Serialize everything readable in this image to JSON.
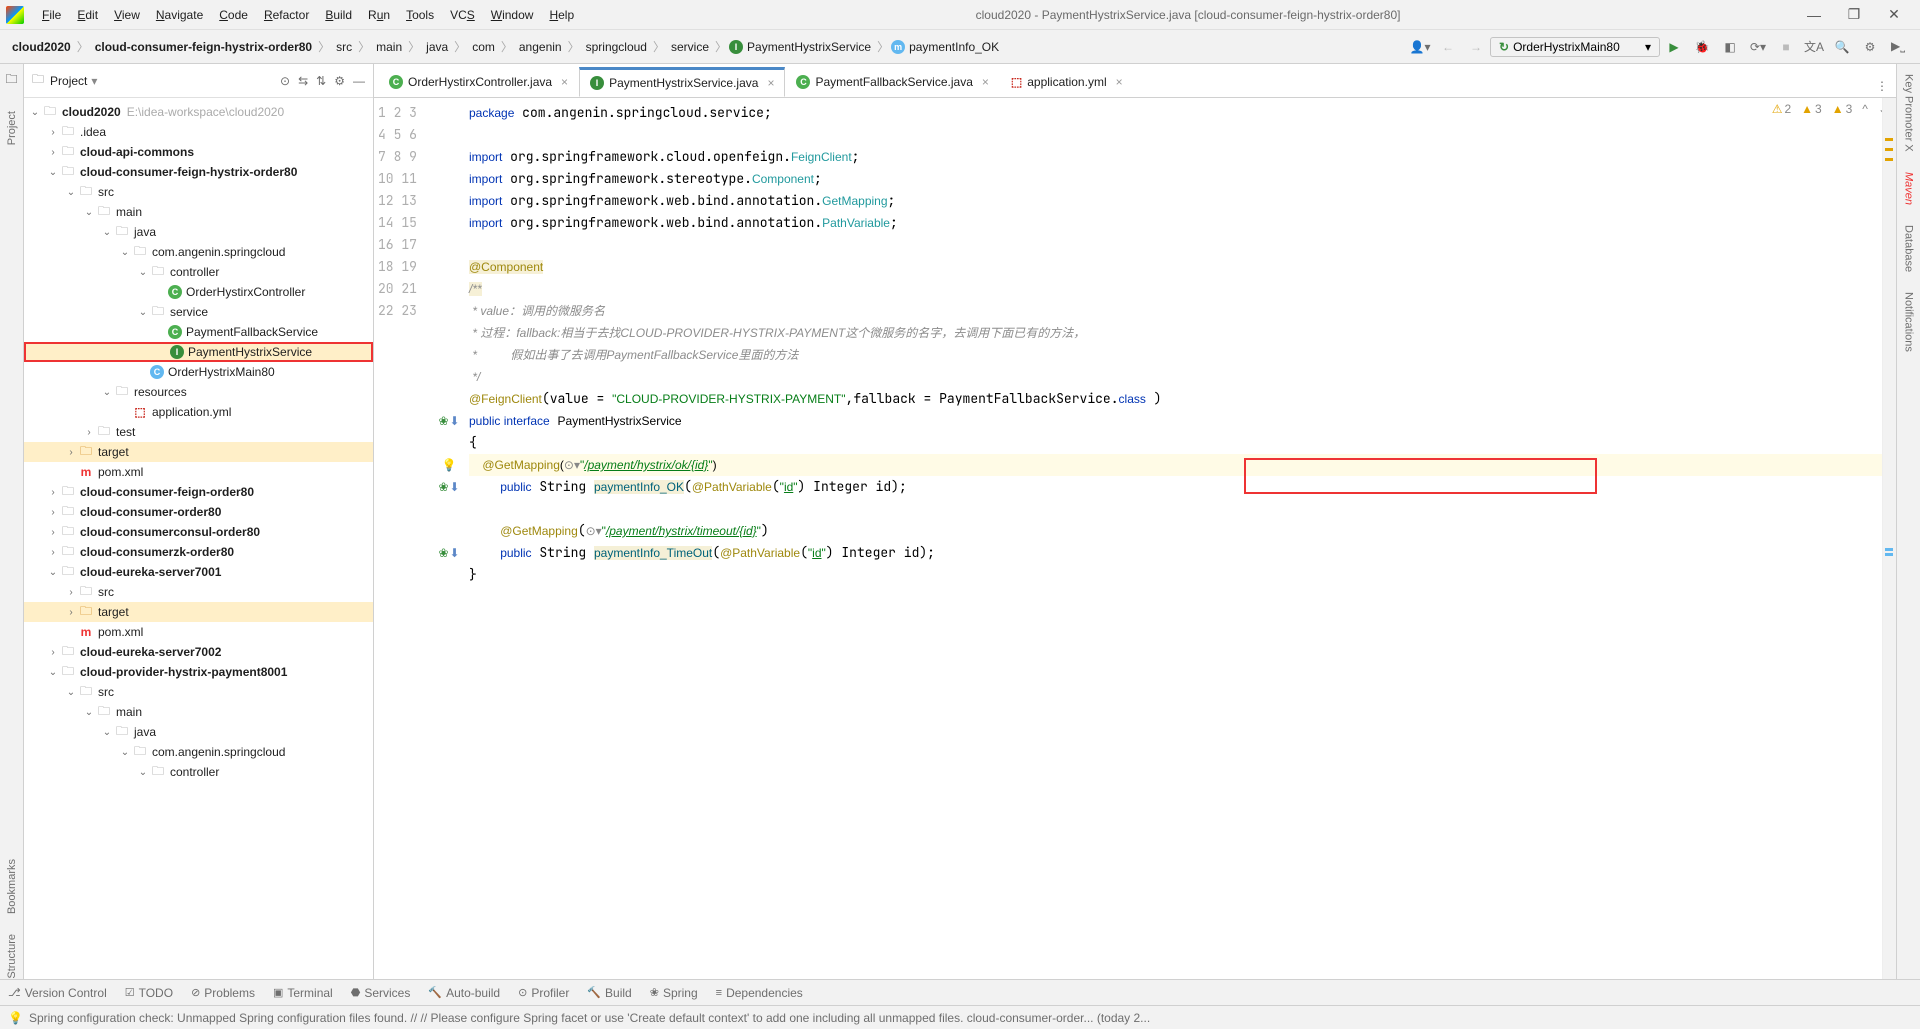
{
  "window": {
    "title": "cloud2020 - PaymentHystrixService.java [cloud-consumer-feign-hystrix-order80]"
  },
  "menu": [
    "File",
    "Edit",
    "View",
    "Navigate",
    "Code",
    "Refactor",
    "Build",
    "Run",
    "Tools",
    "VCS",
    "Window",
    "Help"
  ],
  "breadcrumbs": {
    "project": "cloud2020",
    "module": "cloud-consumer-feign-hystrix-order80",
    "path": [
      "src",
      "main",
      "java",
      "com",
      "angenin",
      "springcloud",
      "service"
    ],
    "file": "PaymentHystrixService",
    "method": "paymentInfo_OK"
  },
  "runConfig": "OrderHystrixMain80",
  "sidebar": {
    "title": "Project",
    "root": "cloud2020",
    "rootPath": "E:\\idea-workspace\\cloud2020",
    "nodes": {
      "idea": ".idea",
      "apicommons": "cloud-api-commons",
      "order80mod": "cloud-consumer-feign-hystrix-order80",
      "src": "src",
      "main": "main",
      "java": "java",
      "pkg": "com.angenin.springcloud",
      "controller": "controller",
      "orderCtrl": "OrderHystirxController",
      "service": "service",
      "pfs": "PaymentFallbackService",
      "phs": "PaymentHystrixService",
      "ohm": "OrderHystrixMain80",
      "resources": "resources",
      "appyml": "application.yml",
      "test": "test",
      "target": "target",
      "pom": "pom.xml",
      "feignorder80": "cloud-consumer-feign-order80",
      "consumerorder80": "cloud-consumer-order80",
      "consulorder80": "cloud-consumerconsul-order80",
      "zkorder80": "cloud-consumerzk-order80",
      "eureka7001": "cloud-eureka-server7001",
      "eureka7002": "cloud-eureka-server7002",
      "hystrix8001": "cloud-provider-hystrix-payment8001"
    }
  },
  "tabs": [
    {
      "icon": "C",
      "iconClass": "java-c",
      "label": "OrderHystirxController.java",
      "active": false
    },
    {
      "icon": "I",
      "iconClass": "java-i",
      "label": "PaymentHystrixService.java",
      "active": true
    },
    {
      "icon": "C",
      "iconClass": "java-c",
      "label": "PaymentFallbackService.java",
      "active": false
    },
    {
      "icon": "y",
      "iconClass": "yaml-icon",
      "label": "application.yml",
      "active": false
    }
  ],
  "inspections": {
    "warn1": "2",
    "warn2": "3",
    "warn3": "3"
  },
  "statusbar": {
    "msg": "Spring configuration check: Unmapped Spring configuration files found. // // Please configure Spring facet or use 'Create default context' to add one including all unmapped files. cloud-consumer-order... (today 2..."
  },
  "bottomTools": [
    "Version Control",
    "TODO",
    "Problems",
    "Terminal",
    "Services",
    "Auto-build",
    "Profiler",
    "Build",
    "Spring",
    "Dependencies"
  ],
  "leftRail": [
    "Project",
    "Bookmarks",
    "Structure"
  ],
  "rightRail": [
    "Key Promoter X",
    "Maven",
    "Database",
    "Notifications"
  ]
}
